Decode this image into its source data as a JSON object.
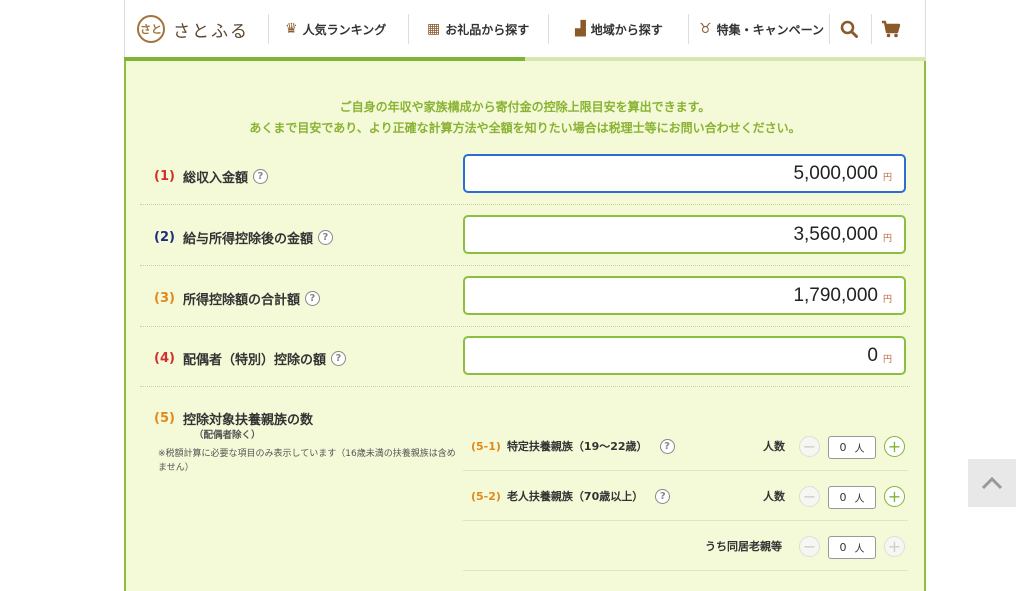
{
  "header": {
    "logo_mark": "さと",
    "logo_text": "さとふる",
    "nav": [
      {
        "icon": "crown-icon",
        "label": "人気ランキング"
      },
      {
        "icon": "gift-icon",
        "label": "お礼品から探す"
      },
      {
        "icon": "map-pin-icon",
        "label": "地域から探す"
      },
      {
        "icon": "medal-icon",
        "label": "特集・キャンペーン"
      }
    ]
  },
  "progress": {
    "fraction": 0.5
  },
  "intro": {
    "line1": "ご自身の年収や家族構成から寄付金の控除上限目安を算出できます。",
    "line2": "あくまで目安であり、より正確な計算方法や全額を知りたい場合は税理士等にお問い合わせください。"
  },
  "rows": [
    {
      "num": "(1)",
      "label": "総収入金額",
      "value": "5,000,000",
      "unit": "円",
      "num_color": "#d0312d"
    },
    {
      "num": "(2)",
      "label": "給与所得控除後の金額",
      "value": "3,560,000",
      "unit": "円",
      "num_color": "#1e2e7a"
    },
    {
      "num": "(3)",
      "label": "所得控除額の合計額",
      "value": "1,790,000",
      "unit": "円",
      "num_color": "#e08a1e"
    },
    {
      "num": "(4)",
      "label": "配偶者（特別）控除の額",
      "value": "0",
      "unit": "円",
      "num_color": "#d0312d"
    }
  ],
  "dependents": {
    "num": "(5)",
    "label": "控除対象扶養親族の数",
    "sublabel": "（配偶者除く）",
    "note": "※税額計算に必要な項目のみ表示しています（16歳未満の扶養親族は含めません）",
    "items": [
      {
        "num": "(5-1)",
        "label": "特定扶養親族（19〜22歳）",
        "count_label": "人数",
        "value": "0",
        "unit": "人"
      },
      {
        "num": "(5-2)",
        "label": "老人扶養親族（70歳以上）",
        "count_label": "人数",
        "value": "0",
        "unit": "人"
      },
      {
        "num": "",
        "label": "",
        "count_label": "うち同居老親等",
        "value": "0",
        "unit": "人"
      }
    ]
  },
  "help_glyph": "?",
  "colors": {
    "accent_green": "#8cbf3f",
    "focus_blue": "#2b6fd1",
    "intro_text": "#8ab334"
  }
}
